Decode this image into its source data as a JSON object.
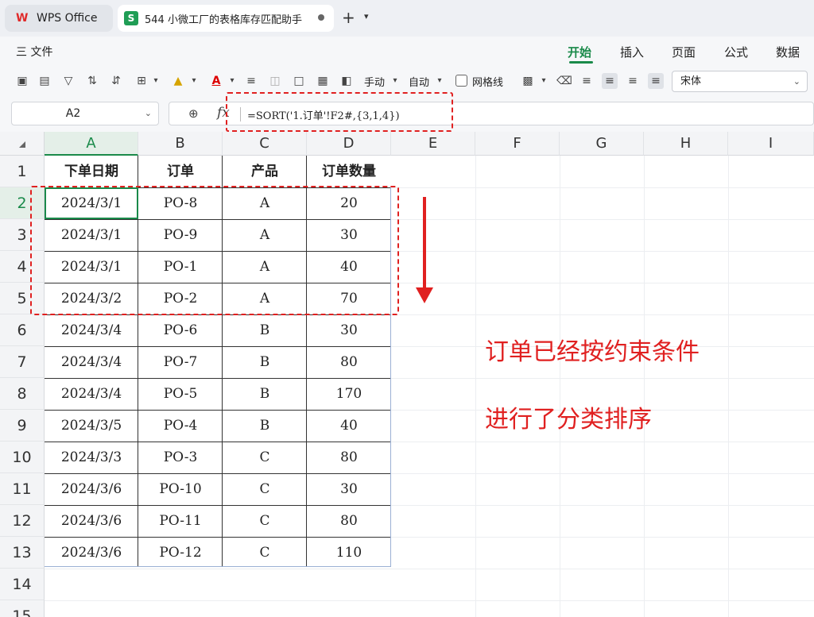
{
  "tabs": {
    "app_tab": "WPS Office",
    "doc_tab": "544 小微工厂的表格库存匹配助手",
    "new_tab_symbol": "+",
    "more_symbol": "⌄"
  },
  "menu": {
    "file": "三 文件",
    "ribbon_tabs": [
      "开始",
      "插入",
      "页面",
      "公式",
      "数据"
    ],
    "active_tab": "开始"
  },
  "toolbar": {
    "manual_label": "手动",
    "auto_label": "自动",
    "gridlines_label": "网格线",
    "font_name": "宋体"
  },
  "formula_bar": {
    "cell_ref": "A2",
    "formula": "=SORT('1.订单'!F2#,{3,1,4})"
  },
  "grid": {
    "columns": [
      "A",
      "B",
      "C",
      "D",
      "E",
      "F",
      "G",
      "H",
      "I"
    ],
    "active_column": "A",
    "row_numbers": [
      "1",
      "2",
      "3",
      "4",
      "5",
      "6",
      "7",
      "8",
      "9",
      "10",
      "11",
      "12",
      "13",
      "14",
      "15"
    ],
    "active_row": "2"
  },
  "table": {
    "headers": [
      "下单日期",
      "订单",
      "产品",
      "订单数量"
    ],
    "rows": [
      [
        "2024/3/1",
        "PO-8",
        "A",
        "20"
      ],
      [
        "2024/3/1",
        "PO-9",
        "A",
        "30"
      ],
      [
        "2024/3/1",
        "PO-1",
        "A",
        "40"
      ],
      [
        "2024/3/2",
        "PO-2",
        "A",
        "70"
      ],
      [
        "2024/3/4",
        "PO-6",
        "B",
        "30"
      ],
      [
        "2024/3/4",
        "PO-7",
        "B",
        "80"
      ],
      [
        "2024/3/4",
        "PO-5",
        "B",
        "170"
      ],
      [
        "2024/3/5",
        "PO-4",
        "B",
        "40"
      ],
      [
        "2024/3/3",
        "PO-3",
        "C",
        "80"
      ],
      [
        "2024/3/6",
        "PO-10",
        "C",
        "30"
      ],
      [
        "2024/3/6",
        "PO-11",
        "C",
        "80"
      ],
      [
        "2024/3/6",
        "PO-12",
        "C",
        "110"
      ]
    ]
  },
  "annotations": {
    "line1": "订单已经按约束条件",
    "line2": "进行了分类排序"
  },
  "colors": {
    "accent_green": "#1a8a4a",
    "annotation_red": "#e02020"
  }
}
